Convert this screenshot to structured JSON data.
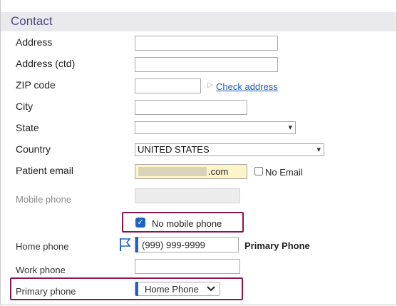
{
  "section": {
    "title": "Contact"
  },
  "fields": {
    "address": {
      "label": "Address",
      "value": ""
    },
    "address_ctd": {
      "label": "Address (ctd)",
      "value": ""
    },
    "zip": {
      "label": "ZIP code",
      "value": "",
      "check_link": "Check address"
    },
    "city": {
      "label": "City",
      "value": ""
    },
    "state": {
      "label": "State",
      "value": ""
    },
    "country": {
      "label": "Country",
      "value": "UNITED STATES"
    },
    "patient_email": {
      "label": "Patient email",
      "value_suffix": ".com",
      "no_email_label": "No Email"
    },
    "mobile_phone": {
      "label": "Mobile phone",
      "value": "",
      "no_mobile_label": "No mobile phone"
    },
    "home_phone": {
      "label": "Home phone",
      "value": "(999) 999-9999",
      "primary_tag": "Primary Phone"
    },
    "work_phone": {
      "label": "Work phone",
      "value": ""
    },
    "primary_phone": {
      "label": "Primary phone",
      "value": "Home Phone"
    }
  },
  "colors": {
    "header_bg": "#e9e9ee",
    "header_text": "#4b4a7a",
    "highlight_border": "#8a1553",
    "link": "#1a5fb4",
    "accent": "#1f64c4",
    "email_fill": "#fdf5c8"
  }
}
